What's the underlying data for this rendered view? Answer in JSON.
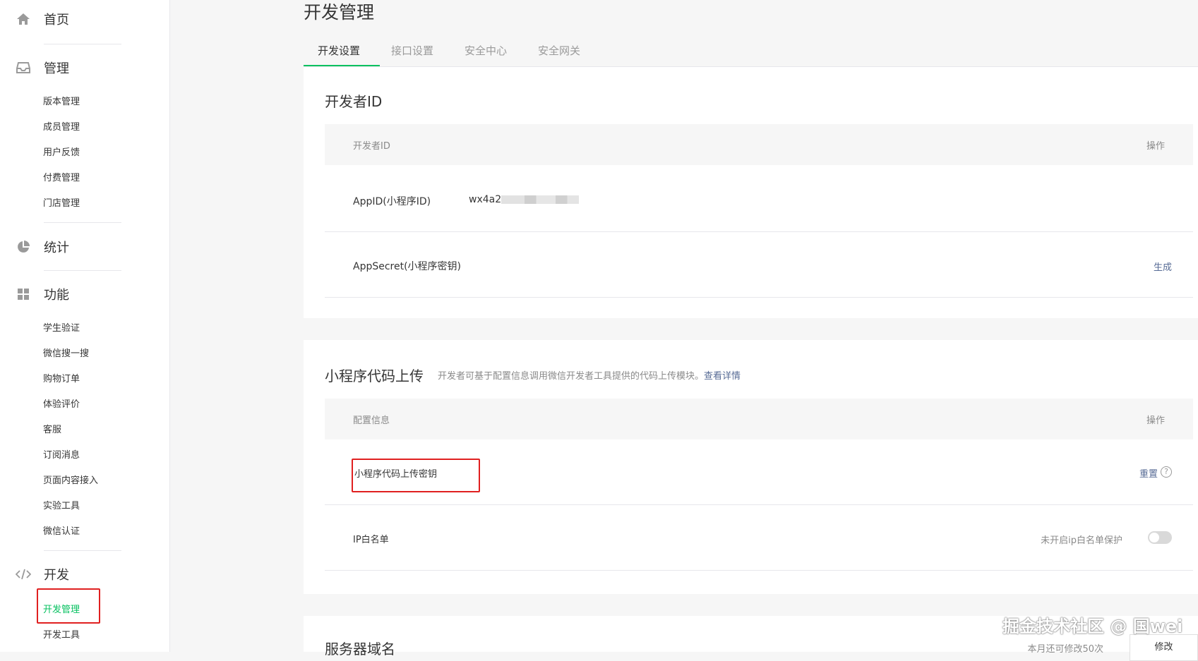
{
  "sidebar": {
    "home": "首页",
    "manage": {
      "title": "管理",
      "items": [
        "版本管理",
        "成员管理",
        "用户反馈",
        "付费管理",
        "门店管理"
      ]
    },
    "stats": "统计",
    "features": {
      "title": "功能",
      "items": [
        "学生验证",
        "微信搜一搜",
        "购物订单",
        "体验评价",
        "客服",
        "订阅消息",
        "页面内容接入",
        "实验工具",
        "微信认证"
      ]
    },
    "dev": {
      "title": "开发",
      "items": [
        "开发管理",
        "开发工具"
      ]
    }
  },
  "main": {
    "title": "开发管理",
    "tabs": [
      "开发设置",
      "接口设置",
      "安全中心",
      "安全网关"
    ],
    "developer_id": {
      "title": "开发者ID",
      "col_name": "开发者ID",
      "col_op": "操作",
      "appid_label": "AppID(小程序ID)",
      "appid_value": "wx4a2",
      "secret_label": "AppSecret(小程序密钥)",
      "secret_op": "生成"
    },
    "upload": {
      "title": "小程序代码上传",
      "desc": "开发者可基于配置信息调用微信开发者工具提供的代码上传模块。",
      "desc_link": "查看详情",
      "col_name": "配置信息",
      "col_op": "操作",
      "key_label": "小程序代码上传密钥",
      "key_op": "重置",
      "ip_label": "IP白名单",
      "ip_status": "未开启ip白名单保护"
    },
    "server": {
      "title": "服务器域名",
      "remain": "本月还可修改50次",
      "modify": "修改"
    }
  },
  "watermark": "掘金技术社区 @ 国wei",
  "colors": {
    "accent": "#07c160",
    "link": "#576b95",
    "highlight": "#e02020"
  }
}
